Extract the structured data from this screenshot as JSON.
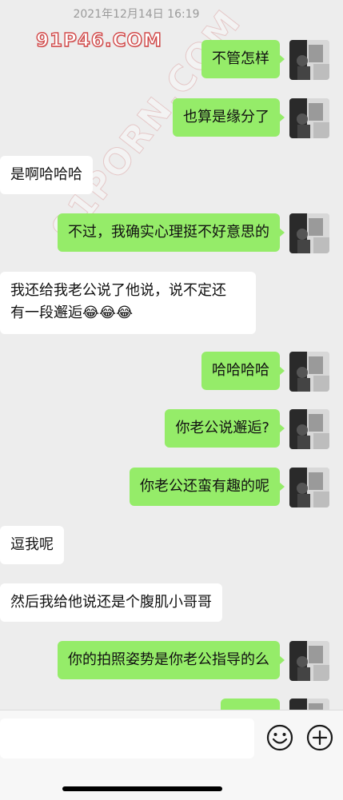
{
  "timestamp": "2021年12月14日 16:19",
  "watermark": "91P46.COM",
  "watermark_diagonal": "91PORN.COM",
  "messages": [
    {
      "direction": "sent",
      "text": "不管怎样"
    },
    {
      "direction": "sent",
      "text": "也算是缘分了"
    },
    {
      "direction": "received",
      "text": "是啊哈哈哈"
    },
    {
      "direction": "sent",
      "text": "不过，我确实心理挺不好意思的"
    },
    {
      "direction": "received",
      "line1": "我还给我老公说了他说，说不定还",
      "line2": "有一段邂逅😂😂😂"
    },
    {
      "direction": "sent",
      "text": "哈哈哈哈"
    },
    {
      "direction": "sent",
      "text": "你老公说邂逅?"
    },
    {
      "direction": "sent",
      "text": "你老公还蛮有趣的呢"
    },
    {
      "direction": "received",
      "text": "逗我呢"
    },
    {
      "direction": "received",
      "text": "然后我给他说还是个腹肌小哥哥"
    },
    {
      "direction": "sent",
      "text": "你的拍照姿势是你老公指导的么"
    }
  ],
  "input_bar": {
    "placeholder": "",
    "icons": [
      "emoji-icon",
      "plus-icon"
    ]
  },
  "colors": {
    "background": "#ededed",
    "sent_bubble": "#95ec69",
    "received_bubble": "#ffffff",
    "watermark": "#d24a4a"
  }
}
